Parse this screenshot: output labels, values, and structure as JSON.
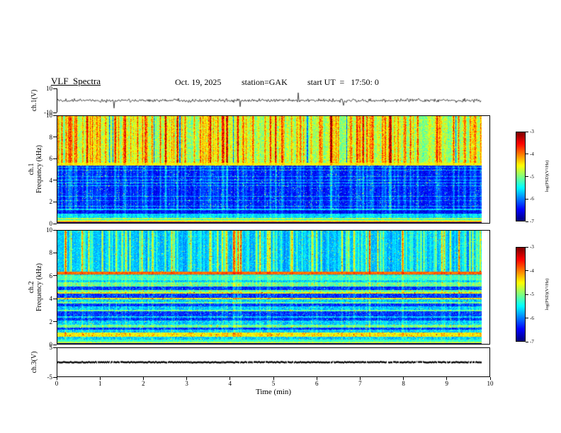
{
  "header": {
    "title": "VLF  Spectra",
    "date": "Oct. 19, 2025",
    "station": "station=GAK",
    "start_ut": "start UT  =   17:50: 0"
  },
  "panels": {
    "ch1_wave": {
      "ylabel": "ch.1(V)",
      "yticks": [
        10,
        -10
      ]
    },
    "ch1_spec": {
      "ylabel_channel": "ch.1",
      "ylabel_axis": "Frequency  (kHz)",
      "yticks": [
        10,
        8,
        6,
        4,
        2,
        0
      ]
    },
    "ch2_spec": {
      "ylabel_channel": "ch.2",
      "ylabel_axis": "Frequency  (kHz)",
      "yticks": [
        10,
        8,
        6,
        4,
        2,
        0
      ]
    },
    "ch3": {
      "ylabel": "ch.3(V)",
      "yticks": [
        5,
        -5
      ]
    }
  },
  "xaxis": {
    "label": "Time  (min)",
    "ticks": [
      0,
      1,
      2,
      3,
      4,
      5,
      6,
      7,
      8,
      9,
      10
    ]
  },
  "colorbar": {
    "label": "log(PSD)(V²/Hz)",
    "ticks": [
      -3,
      -4,
      -5,
      -6,
      -7
    ]
  },
  "chart_data": [
    {
      "id": "ch1_wave",
      "type": "line",
      "ylabel": "ch.1(V)",
      "ylim": [
        -10,
        10
      ],
      "xlim": [
        0,
        10
      ],
      "x_data_end": 9.8,
      "description": "Channel 1 raw voltage time series: continuous noise band of roughly +/-2 V about 0 V with frequent impulsive sferic spikes reaching toward +/-10 V"
    },
    {
      "id": "ch1_spec",
      "type": "heatmap",
      "ylabel": "Frequency (kHz)",
      "ylim": [
        0,
        10
      ],
      "xlim": [
        0,
        10
      ],
      "x_data_end": 9.8,
      "zlim": [
        -7,
        -3
      ],
      "colorbar_label": "log(PSD)(V²/Hz)",
      "features": {
        "streak_band_khz": [
          5.6,
          10
        ],
        "narrow_line_khz": 5.5,
        "quiet_band_khz": [
          1.3,
          5.4
        ],
        "stripe_band_khz": [
          0.35,
          1.3
        ],
        "bottom_band_khz": [
          0,
          0.35
        ]
      },
      "description": "Dense vertical broadband lightning-sferic streaks (green/yellow/red on cyan) above ~5.5 kHz, bright narrow horizontal line near 5.5 kHz, dark blue quiet band 1.3-5.4 kHz with faint horizontal lines and cyan streak columns, banded green/yellow stripes 0.35-1.3 kHz, bright red/yellow band just above 0 kHz with black bottom edge"
    },
    {
      "id": "ch2_spec",
      "type": "heatmap",
      "ylabel": "Frequency (kHz)",
      "ylim": [
        0,
        10
      ],
      "xlim": [
        0,
        10
      ],
      "x_data_end": 9.8,
      "zlim": [
        -7,
        -3
      ],
      "colorbar_label": "log(PSD)(V²/Hz)",
      "features": {
        "streak_band_khz": [
          6.38,
          10
        ],
        "narrow_line_khz": 6.2,
        "green_band_khz": [
          5.6,
          6.08
        ],
        "stripe_band_khz": [
          0.35,
          5.6
        ],
        "bottom_band_khz": [
          0,
          0.35
        ]
      },
      "description": "Blue background with vertical sferic streaks above ~6.4 kHz, bright yellow-orange narrow line near 6.2 kHz, green band just below it, dense horizontal cyan/green/blue banding with speckle 0.35-5.6 kHz, bright band near 0 kHz with black bottom edge"
    },
    {
      "id": "ch3",
      "type": "line",
      "ylabel": "ch.3(V)",
      "ylim": [
        -5,
        5
      ],
      "xlim": [
        0,
        10
      ],
      "x_data_end": 9.8,
      "value": 0,
      "description": "Channel 3 voltage: flat constant trace at ~0 V for the whole 10 minute record"
    }
  ]
}
